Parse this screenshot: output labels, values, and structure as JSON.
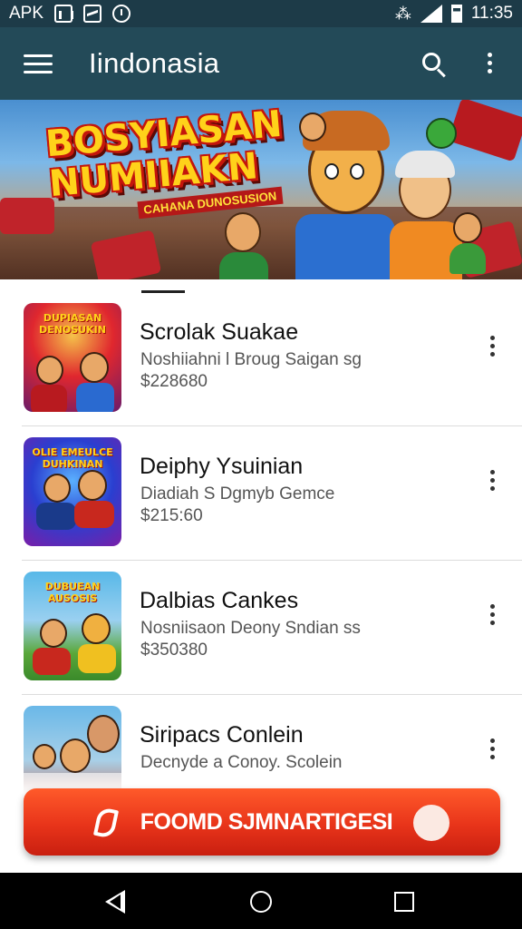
{
  "status_bar": {
    "left_text": "APK",
    "time": "11:35",
    "icons": [
      "chart-icon",
      "graph-icon",
      "clock-icon",
      "vibrate-icon",
      "signal-icon",
      "battery-icon"
    ]
  },
  "app_bar": {
    "title": "Iindonasia",
    "icons": [
      "menu-icon",
      "search-icon",
      "overflow-icon"
    ]
  },
  "banner": {
    "title_line1": "BOSYIASAN",
    "title_line2": "NUMIIAKN",
    "subtitle": "CAHANA DUNOSUSION"
  },
  "list": {
    "items": [
      {
        "title": "Scrolak Suakae",
        "subtitle": "Noshiiahni l Broug Saigan sg",
        "price": "$228680",
        "thumb_text": "DUPIASAN DENOSUKIN",
        "thumb_colors": [
          "#e0272e",
          "#6a1b6a"
        ]
      },
      {
        "title": "Deiphy Ysuinian",
        "subtitle": "Diadiah S Dgmyb Gemce",
        "price": "$215:60",
        "thumb_text": "OLIE EMEULCE DUHKINAN",
        "thumb_colors": [
          "#2a3fd0",
          "#7a1ea8"
        ]
      },
      {
        "title": "Dalbias Cankes",
        "subtitle": "Nosniisaon Deony Sndian ss",
        "price": "$350380",
        "thumb_text": "DUBUEAN AUSOSIS",
        "thumb_colors": [
          "#58b8e8",
          "#3a8a2a"
        ]
      },
      {
        "title": "Siripacs Conlein",
        "subtitle": "Decnyde a Conoy. Scolein",
        "price": "",
        "thumb_text": "",
        "thumb_colors": [
          "#6ab8e8",
          "#c84a2a"
        ]
      }
    ]
  },
  "cta": {
    "label": "FOOMD SJMNARTIGESI"
  },
  "colors": {
    "status_bar": "#1d3b48",
    "app_bar": "#234a58",
    "cta_top": "#ff5a2a",
    "cta_bottom": "#c91f10",
    "banner_title": "#ffd21a"
  }
}
